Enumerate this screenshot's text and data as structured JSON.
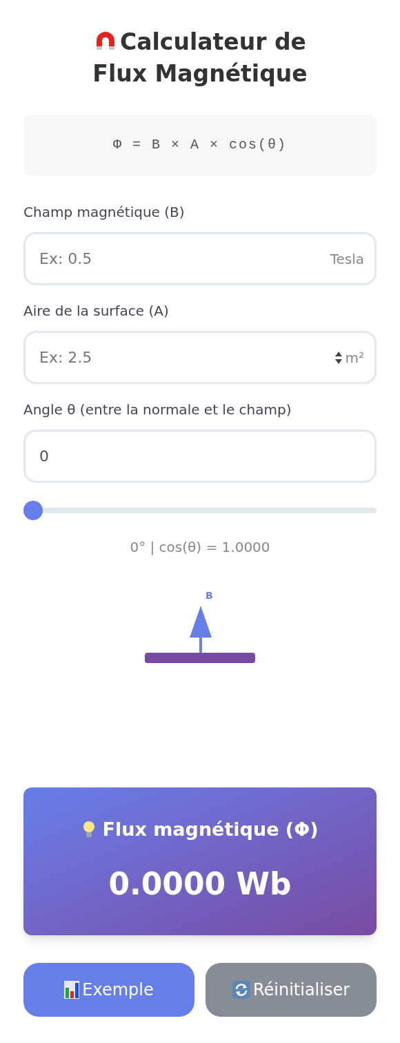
{
  "title": "Calculateur de Flux Magnétique",
  "formula": "Φ = B × A × cos(θ)",
  "fields": [
    {
      "label": "Champ magnétique (B)",
      "placeholder": "Ex: 0.5",
      "unit": "Tesla",
      "spinner": false
    },
    {
      "label": "Aire de la surface (A)",
      "placeholder": "Ex: 2.5",
      "unit": "m²",
      "spinner": true
    },
    {
      "label": "Angle θ (entre la normale et le champ)",
      "value": "0",
      "spinner": false
    }
  ],
  "slider": {
    "level": 0
  },
  "angle_reading": "0° | cos(θ) = 1.0000",
  "diagram": {
    "field_label": "B"
  },
  "result": {
    "title": "Flux magnétique (Φ)",
    "value": "0.0000 Wb"
  },
  "buttons": [
    {
      "kind": "example",
      "label": "Exemple"
    },
    {
      "kind": "reset",
      "label": "Réinitialiser"
    }
  ]
}
